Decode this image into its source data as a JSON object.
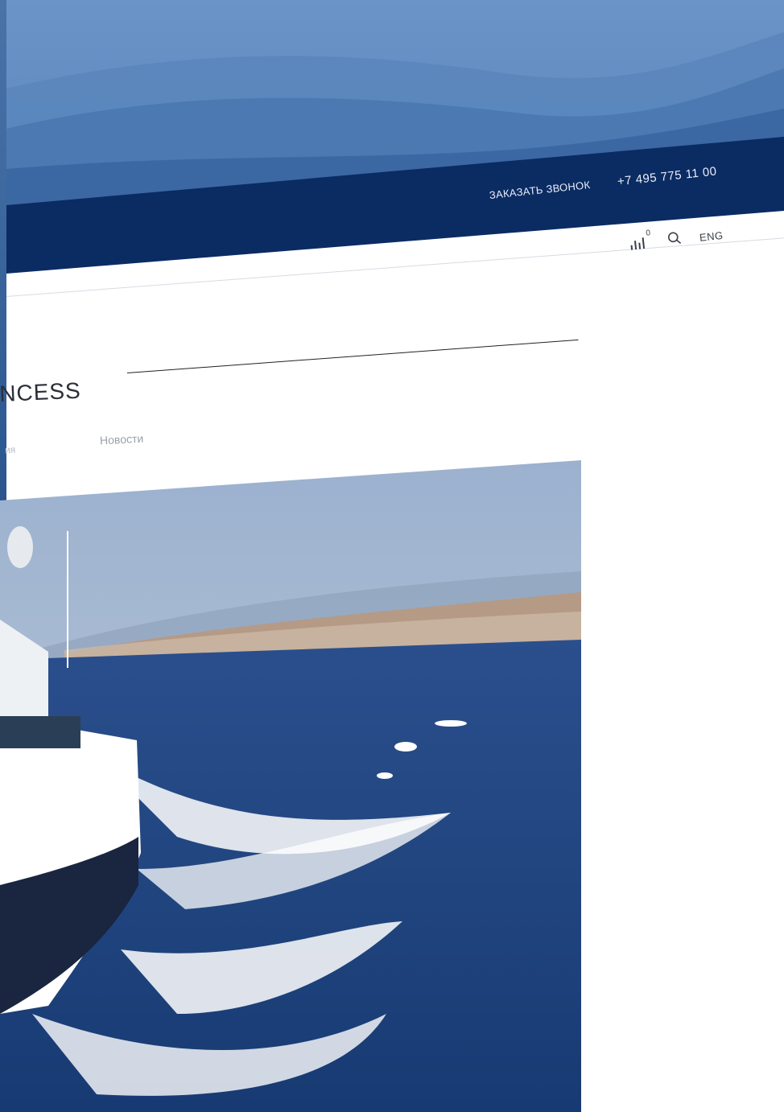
{
  "header": {
    "callback_label": "ЗАКАЗАТЬ ЗВОНОК",
    "phone": "+7 495 775 11 00",
    "compare_count": "0",
    "lang_label": "ENG"
  },
  "page": {
    "title": "NCESS",
    "tabs": [
      {
        "label": "ия"
      },
      {
        "label": "Новости"
      }
    ]
  },
  "icons": {
    "compare": "bar-chart-icon",
    "search": "search-icon"
  },
  "colors": {
    "header_dark": "#0b2b63",
    "header_light": "#5b88bf",
    "sea": "#1f4a8c"
  }
}
